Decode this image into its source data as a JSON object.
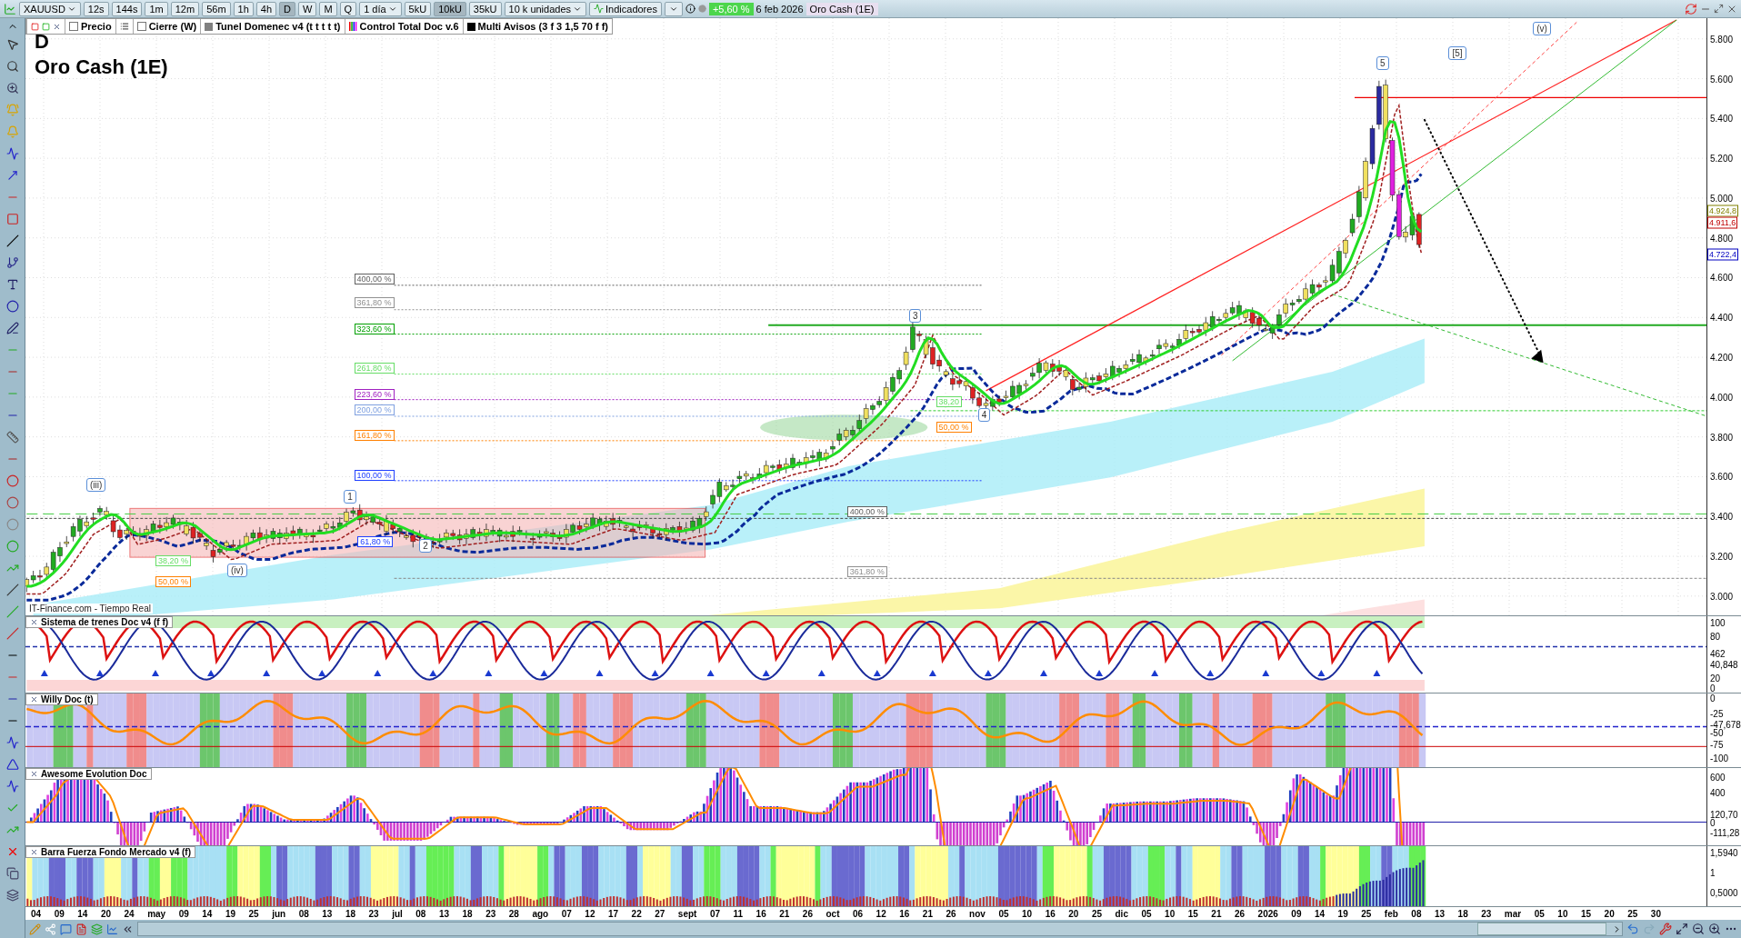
{
  "toolbar": {
    "symbol": "XAUUSD",
    "timeframes": [
      {
        "label": "12s",
        "selected": false
      },
      {
        "label": "144s",
        "selected": false
      },
      {
        "label": "1m",
        "selected": false
      },
      {
        "label": "12m",
        "selected": false
      },
      {
        "label": "56m",
        "selected": false
      },
      {
        "label": "1h",
        "selected": false
      },
      {
        "label": "4h",
        "selected": false
      },
      {
        "label": "D",
        "selected": true
      },
      {
        "label": "W",
        "selected": false
      },
      {
        "label": "M",
        "selected": false
      },
      {
        "label": "Q",
        "selected": false
      }
    ],
    "period": "1 día",
    "units": [
      {
        "label": "5kU",
        "selected": false
      },
      {
        "label": "10kU",
        "selected": true
      },
      {
        "label": "35kU",
        "selected": false
      }
    ],
    "unit_size": "10 k unidades",
    "indicators_button": "Indicadores",
    "change": "+5,60 %",
    "date": "6 feb 2026",
    "instrument": "Oro Cash (1E)"
  },
  "indicator_bar": [
    {
      "kind": "checkbox",
      "label": "Precio",
      "checked": false
    },
    {
      "kind": "list"
    },
    {
      "kind": "checkbox",
      "label": "Cierre (W)",
      "checked": false
    },
    {
      "kind": "swatch",
      "label": "Tunel Domenec v4 (t t t t t)",
      "color": "#808080"
    },
    {
      "kind": "stripes",
      "label": "Control Total Doc v.6"
    },
    {
      "kind": "swatch",
      "label": "Multi Avisos (3 f 3 1,5 70 f f)",
      "color": "#000000"
    }
  ],
  "chart": {
    "timeframe": "D",
    "title": "Oro Cash (1E)",
    "source": "IT-Finance.com - Tiempo Real",
    "price_axis": [
      "5.800",
      "5.600",
      "5.400",
      "5.200",
      "5.000",
      "4.800",
      "4.600",
      "4.400",
      "4.200",
      "4.000",
      "3.800",
      "3.600",
      "3.400",
      "3.200",
      "3.000"
    ],
    "price_tags": [
      {
        "label": "4.924,8",
        "color": "#808000"
      },
      {
        "label": "4.911,6",
        "color": "#c00000"
      },
      {
        "label": "4.722,4",
        "color": "#0000c0"
      }
    ],
    "fib_labels": [
      {
        "label": "400,00 %",
        "color": "#606060"
      },
      {
        "label": "361,80 %",
        "color": "#909090"
      },
      {
        "label": "323,60 %",
        "color": "#00a000"
      },
      {
        "label": "261,80 %",
        "color": "#66dd66"
      },
      {
        "label": "223,60 %",
        "color": "#a020c0"
      },
      {
        "label": "200,00 %",
        "color": "#7fa0e0"
      },
      {
        "label": "161,80 %",
        "color": "#ff8000"
      },
      {
        "label": "100,00 %",
        "color": "#2040ff"
      },
      {
        "label": "400,00 %",
        "color": "#606060"
      },
      {
        "label": "361,80 %",
        "color": "#909090"
      },
      {
        "label": "61,80 %",
        "color": "#2040ff"
      },
      {
        "label": "38,20 %",
        "color": "#66dd66"
      },
      {
        "label": "50,00 %",
        "color": "#ff8000"
      },
      {
        "label": "38,20",
        "color": "#66dd66"
      },
      {
        "label": "50,00 %",
        "color": "#ff8000"
      }
    ],
    "wave_labels": [
      "(iii)",
      "(iv)",
      "1",
      "2",
      "3",
      "4",
      "5",
      "[5]",
      "(v)"
    ]
  },
  "panels": [
    {
      "kind": "trains",
      "title": "Sistema de trenes Doc v4 (f f)",
      "axis": [
        "100",
        "80",
        "462",
        "40,848",
        "20",
        "0"
      ]
    },
    {
      "kind": "willy",
      "title": "Willy Doc (t)",
      "axis": [
        "0",
        "-25",
        "-47,678",
        "-50",
        "-75",
        "-100"
      ]
    },
    {
      "kind": "awesome",
      "title": "Awesome Evolution Doc",
      "axis": [
        "600",
        "400",
        "120,70",
        "0",
        "-111,28"
      ]
    },
    {
      "kind": "strength",
      "title": "Barra Fuerza Fondo Mercado v4 (f)",
      "axis": [
        "1,5940",
        "1",
        "0,5000"
      ]
    }
  ],
  "time_axis": [
    "04",
    "09",
    "14",
    "20",
    "24",
    "may",
    "09",
    "14",
    "19",
    "25",
    "jun",
    "08",
    "13",
    "18",
    "23",
    "jul",
    "08",
    "13",
    "18",
    "23",
    "28",
    "ago",
    "07",
    "12",
    "17",
    "22",
    "27",
    "sept",
    "07",
    "11",
    "16",
    "21",
    "26",
    "oct",
    "06",
    "12",
    "16",
    "21",
    "26",
    "nov",
    "05",
    "10",
    "16",
    "20",
    "25",
    "dic",
    "05",
    "10",
    "15",
    "21",
    "26",
    "2026",
    "09",
    "14",
    "19",
    "25",
    "feb",
    "08",
    "13",
    "18",
    "23",
    "mar",
    "05",
    "10",
    "15",
    "20",
    "25",
    "30"
  ]
}
